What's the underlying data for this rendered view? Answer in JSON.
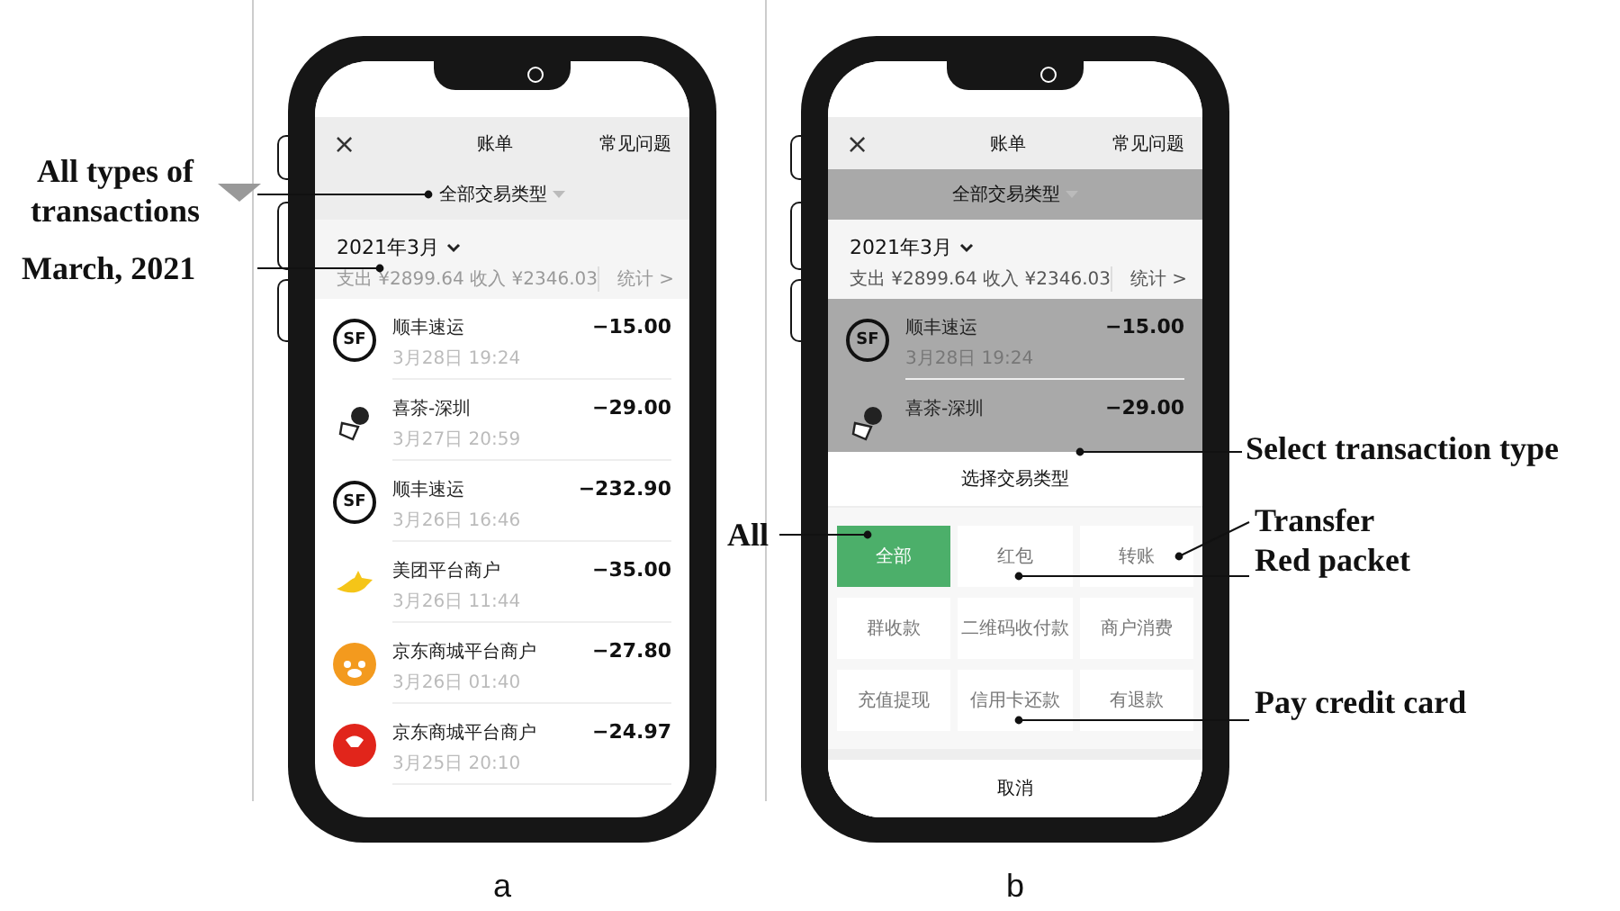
{
  "phones": [
    {
      "caption": "a",
      "close": "×",
      "title": "账单",
      "faq": "常见问题",
      "filter": "全部交易类型",
      "month": "2021年3月",
      "summary": "支出 ¥2899.64 收入 ¥2346.03",
      "stats": "统计 >",
      "sheet_open": false,
      "rows": [
        {
          "kind": "sf",
          "logo_text": "SF",
          "name": "顺丰速运",
          "date": "3月28日 19:24",
          "amount": "−15.00"
        },
        {
          "kind": "tea",
          "name": "喜茶-深圳",
          "date": "3月27日 20:59",
          "amount": "−29.00"
        },
        {
          "kind": "sf",
          "logo_text": "SF",
          "name": "顺丰速运",
          "date": "3月26日 16:46",
          "amount": "−232.90"
        },
        {
          "kind": "kangaroo",
          "name": "美团平台商户",
          "date": "3月26日 11:44",
          "amount": "−35.00"
        },
        {
          "kind": "dog",
          "name": "京东商城平台商户",
          "date": "3月26日 01:40",
          "amount": "−27.80"
        },
        {
          "kind": "red",
          "name": "京东商城平台商户",
          "date": "3月25日 20:10",
          "amount": "−24.97"
        }
      ]
    },
    {
      "caption": "b",
      "close": "×",
      "title": "账单",
      "faq": "常见问题",
      "filter": "全部交易类型",
      "month": "2021年3月",
      "summary": "支出 ¥2899.64 收入 ¥2346.03",
      "stats": "统计 >",
      "sheet_open": true,
      "rows": [
        {
          "kind": "sf",
          "logo_text": "SF",
          "name": "顺丰速运",
          "date": "3月28日 19:24",
          "amount": "−15.00"
        },
        {
          "kind": "tea",
          "name": "喜茶-深圳",
          "amount": "−29.00"
        }
      ],
      "sheet": {
        "title": "选择交易类型",
        "cancel": "取消",
        "options": [
          {
            "label": "全部",
            "selected": true
          },
          {
            "label": "红包",
            "selected": false
          },
          {
            "label": "转账",
            "selected": false
          },
          {
            "label": "群收款",
            "selected": false
          },
          {
            "label": "二维码收付款",
            "selected": false
          },
          {
            "label": "商户消费",
            "selected": false
          },
          {
            "label": "充值提现",
            "selected": false
          },
          {
            "label": "信用卡还款",
            "selected": false
          },
          {
            "label": "有退款",
            "selected": false
          }
        ]
      }
    }
  ],
  "annotations": [
    {
      "text": "All types of transactions"
    },
    {
      "text": "March, 2021"
    },
    {
      "text": "Select transaction type"
    },
    {
      "text": "All"
    },
    {
      "text": "Transfer"
    },
    {
      "text": "Red packet"
    },
    {
      "text": "Pay credit card"
    }
  ]
}
